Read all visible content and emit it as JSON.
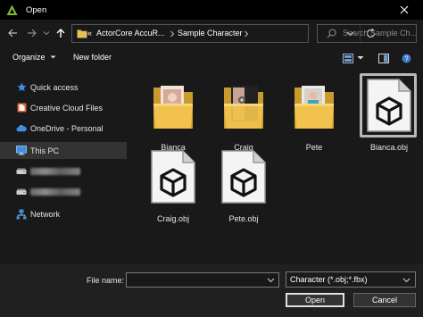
{
  "window": {
    "title": "Open",
    "accent": "#7fb83b"
  },
  "address": {
    "overflow": "«",
    "crumbs": [
      "ActorCore AccuR...",
      "Sample Character"
    ]
  },
  "search": {
    "placeholder": "Search Sample Ch..."
  },
  "toolbar": {
    "organize": "Organize",
    "new_folder": "New folder"
  },
  "nav": {
    "items": [
      {
        "label": "Quick access",
        "icon": "star-icon"
      },
      {
        "label": "Creative Cloud Files",
        "icon": "creative-cloud-icon"
      },
      {
        "label": "OneDrive - Personal",
        "icon": "cloud-icon"
      },
      {
        "label": "This PC",
        "icon": "computer-icon",
        "selected": true
      },
      {
        "label": "",
        "icon": "drive-icon",
        "redacted": true
      },
      {
        "label": "",
        "icon": "drive-icon",
        "redacted": true
      },
      {
        "label": "Network",
        "icon": "network-icon"
      }
    ]
  },
  "files": [
    {
      "name": "Bianca",
      "type": "folder"
    },
    {
      "name": "Craig",
      "type": "folder"
    },
    {
      "name": "Pete",
      "type": "folder"
    },
    {
      "name": "Bianca.obj",
      "type": "obj",
      "selected": true
    },
    {
      "name": "Craig.obj",
      "type": "obj"
    },
    {
      "name": "Pete.obj",
      "type": "obj"
    }
  ],
  "bottom": {
    "file_name_label": "File name:",
    "file_name_value": "",
    "file_type": "Character (*.obj;*.fbx)",
    "open": "Open",
    "cancel": "Cancel"
  }
}
